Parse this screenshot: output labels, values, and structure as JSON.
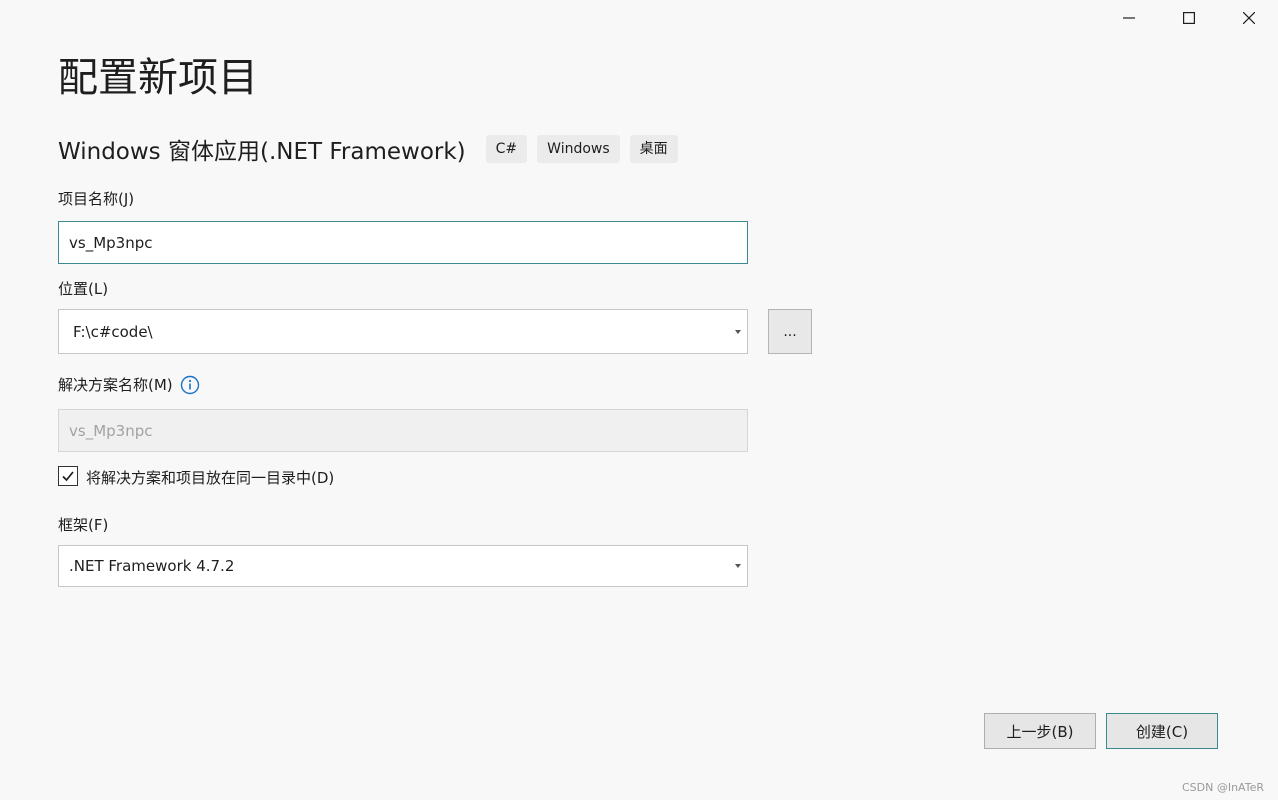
{
  "window": {
    "minimize_icon": "minimize-icon",
    "maximize_icon": "maximize-icon",
    "close_icon": "close-icon"
  },
  "page_title": "配置新项目",
  "template": {
    "name": "Windows 窗体应用(.NET Framework)",
    "tags": [
      "C#",
      "Windows",
      "桌面"
    ]
  },
  "project_name": {
    "label": "项目名称(J)",
    "value": "vs_Mp3npc"
  },
  "location": {
    "label": "位置(L)",
    "value": "F:\\c#code\\",
    "browse_label": "..."
  },
  "solution_name": {
    "label": "解决方案名称(M)",
    "value": "vs_Mp3npc",
    "info_icon": "info-icon"
  },
  "same_directory": {
    "label": "将解决方案和项目放在同一目录中(D)",
    "checked": true
  },
  "framework": {
    "label": "框架(F)",
    "value": ".NET Framework 4.7.2"
  },
  "buttons": {
    "back": "上一步(B)",
    "create": "创建(C)"
  },
  "watermark": "CSDN @InATeR",
  "colors": {
    "accent": "#3c8a91",
    "info_blue": "#1a73c9",
    "background": "#f8f8f8"
  }
}
